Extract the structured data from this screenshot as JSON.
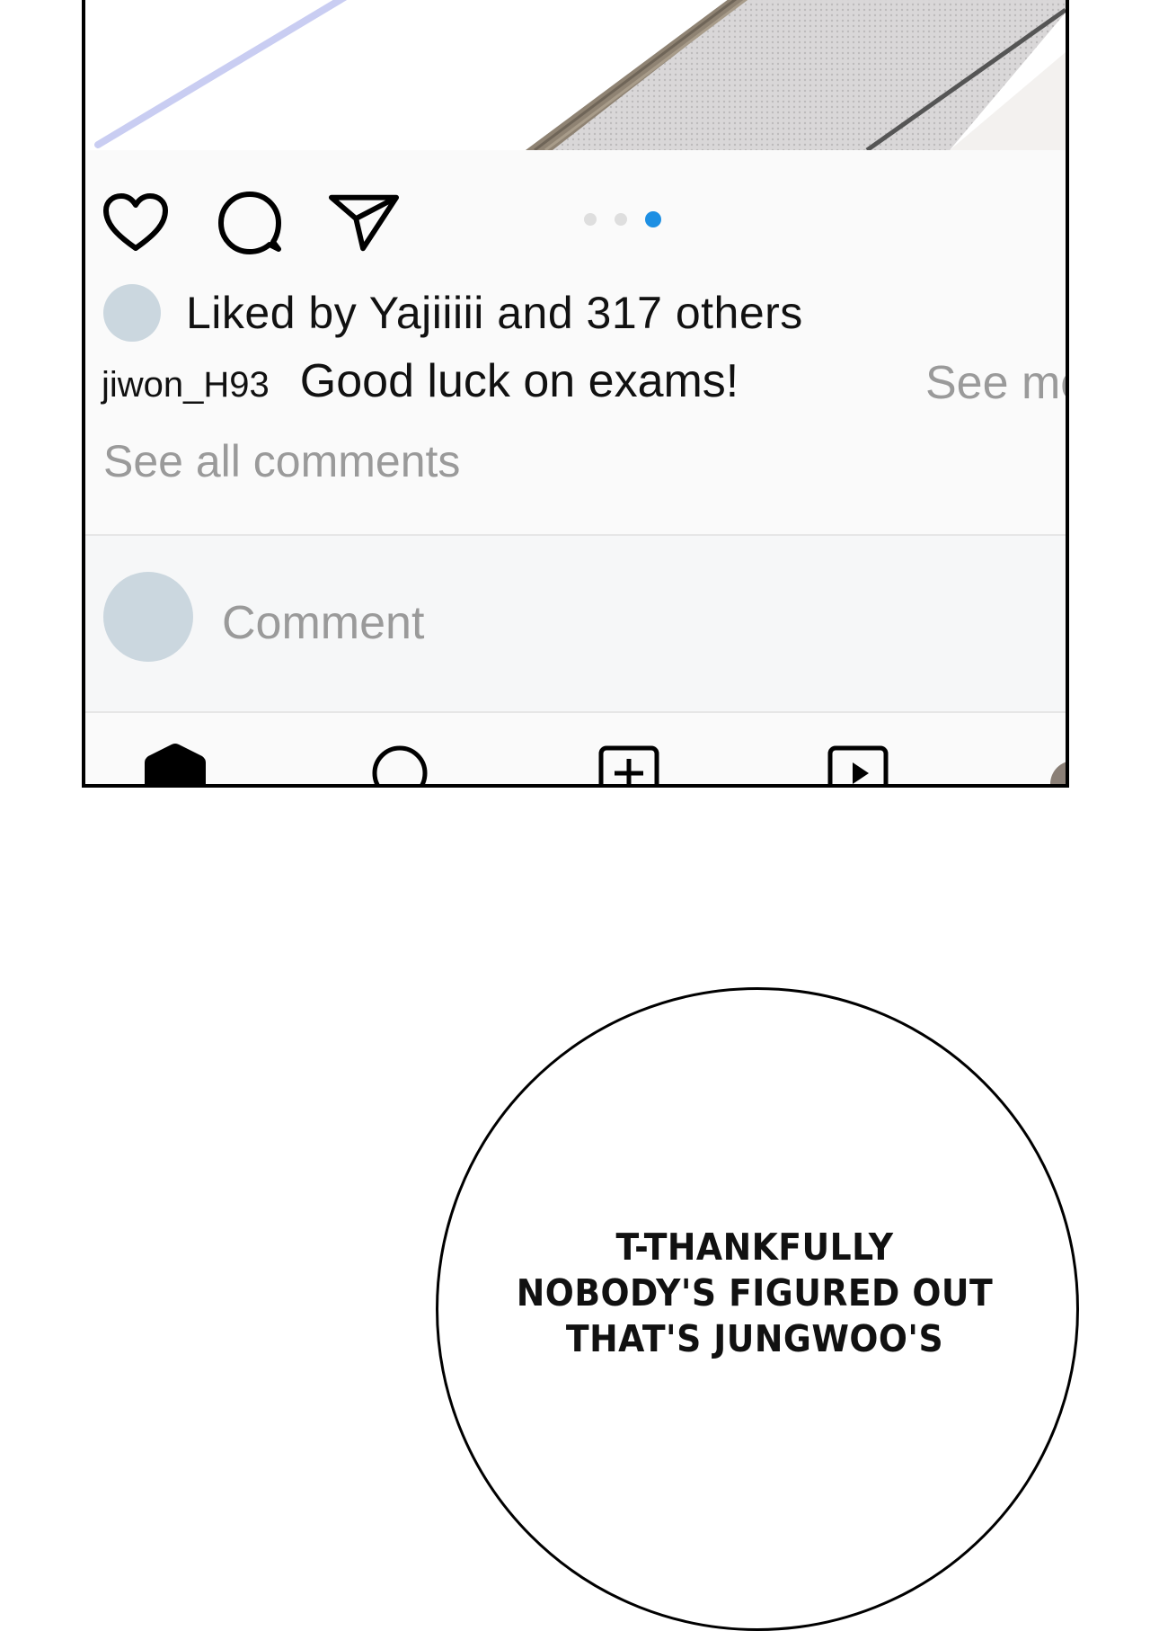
{
  "post": {
    "likes_text": "Liked by Yajiiiii and 317 others",
    "caption_username": "jiwon_H93",
    "caption_text": "Good luck on exams!",
    "see_more": "See more",
    "see_all_comments": "See all comments",
    "carousel": {
      "count": 3,
      "active_index": 2
    }
  },
  "comment": {
    "placeholder": "Comment"
  },
  "actions": [
    "heart-icon",
    "comment-icon",
    "send-icon"
  ],
  "nav": [
    "home-icon",
    "search-icon",
    "add-post-icon",
    "reels-icon",
    "profile-icon"
  ],
  "colors": {
    "accent": "#1d8fe3",
    "avatar": "#cbd7df",
    "muted_text": "#9a9a9a"
  },
  "speech_bubble": {
    "lines": [
      "T-THANKFULLY",
      "NOBODY'S FIGURED OUT",
      "THAT'S JUNGWOO'S"
    ]
  }
}
